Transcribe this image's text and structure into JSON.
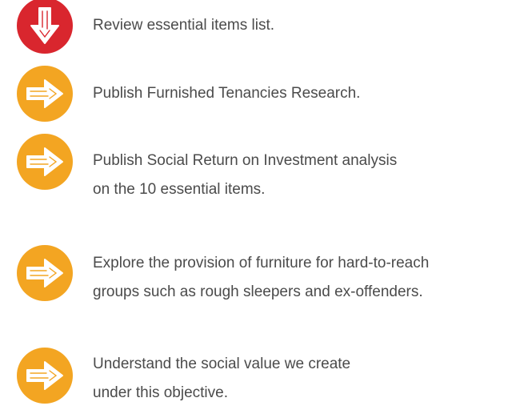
{
  "colors": {
    "red": "#d9262e",
    "orange": "#f3a522",
    "text": "#4b4b4b",
    "arrow": "#ffffff"
  },
  "items": [
    {
      "icon": "arrow-down-icon",
      "color": "#d9262e",
      "lines": [
        "Review essential items list."
      ]
    },
    {
      "icon": "arrow-right-icon",
      "color": "#f3a522",
      "lines": [
        "Publish Furnished Tenancies Research."
      ]
    },
    {
      "icon": "arrow-right-icon",
      "color": "#f3a522",
      "lines": [
        "Publish Social Return on Investment analysis",
        "on the 10 essential items."
      ]
    },
    {
      "icon": "arrow-right-icon",
      "color": "#f3a522",
      "lines": [
        "Explore the provision of furniture for hard-to-reach",
        "groups such as rough sleepers and ex-offenders."
      ]
    },
    {
      "icon": "arrow-right-icon",
      "color": "#f3a522",
      "lines": [
        "Understand the social value we create",
        "under this objective."
      ]
    }
  ]
}
